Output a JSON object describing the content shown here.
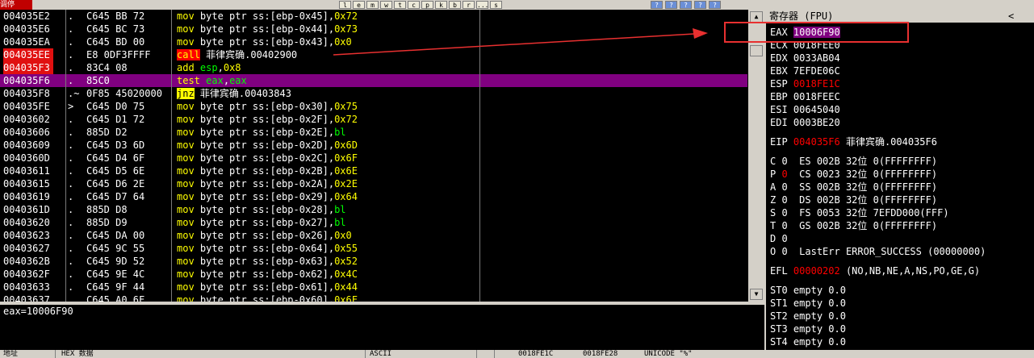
{
  "toolbar": {
    "left_tag": "调停",
    "buttons": [
      "l",
      "e",
      "m",
      "w",
      "t",
      "c",
      "p",
      "k",
      "b",
      "r",
      "...",
      "s"
    ],
    "right_icons": [
      "?",
      "?",
      "?",
      "?",
      "?"
    ]
  },
  "disasm_rows": [
    {
      "addr": "004035E2",
      "mark": ".",
      "hex": "C645 BB 72",
      "tokens": [
        {
          "t": "mov",
          "c": "mn"
        },
        {
          "t": " byte ptr ss:[ebp-0x45],",
          "c": "cn"
        },
        {
          "t": "0x72",
          "c": "num"
        }
      ]
    },
    {
      "addr": "004035E6",
      "mark": ".",
      "hex": "C645 BC 73",
      "tokens": [
        {
          "t": "mov",
          "c": "mn"
        },
        {
          "t": " byte ptr ss:[ebp-0x44],",
          "c": "cn"
        },
        {
          "t": "0x73",
          "c": "num"
        }
      ]
    },
    {
      "addr": "004035EA",
      "mark": ".",
      "hex": "C645 BD 00",
      "tokens": [
        {
          "t": "mov",
          "c": "mn"
        },
        {
          "t": " byte ptr ss:[ebp-0x43],",
          "c": "cn"
        },
        {
          "t": "0x0",
          "c": "num"
        }
      ]
    },
    {
      "addr": "004035EE",
      "addr_red": true,
      "mark": ".",
      "hex": "E8 0DF3FFFF",
      "tokens": [
        {
          "t": "call",
          "c": "mn call"
        },
        {
          "t": " 菲律宾确.00402900",
          "c": "cn"
        }
      ]
    },
    {
      "addr": "004035F3",
      "addr_red": true,
      "mark": ".",
      "hex": "83C4 08",
      "tokens": [
        {
          "t": "add",
          "c": "mn"
        },
        {
          "t": " ",
          "c": "cn"
        },
        {
          "t": "esp",
          "c": "reg"
        },
        {
          "t": ",",
          "c": "cn"
        },
        {
          "t": "0x8",
          "c": "num"
        }
      ]
    },
    {
      "addr": "004035F6",
      "current": true,
      "mark": ".",
      "hex": "85C0",
      "tokens": [
        {
          "t": "test",
          "c": "mn"
        },
        {
          "t": " ",
          "c": "cn"
        },
        {
          "t": "eax",
          "c": "reg"
        },
        {
          "t": ",",
          "c": "cn"
        },
        {
          "t": "eax",
          "c": "reg"
        }
      ]
    },
    {
      "addr": "004035F8",
      "mark": ".~",
      "hex": "0F85 45020000",
      "tokens": [
        {
          "t": "jnz",
          "c": "mn jmp"
        },
        {
          "t": " 菲律宾确.00403843",
          "c": "cn"
        }
      ]
    },
    {
      "addr": "004035FE",
      "mark": ">",
      "hex": "C645 D0 75",
      "tokens": [
        {
          "t": "mov",
          "c": "mn"
        },
        {
          "t": " byte ptr ss:[ebp-0x30],",
          "c": "cn"
        },
        {
          "t": "0x75",
          "c": "num"
        }
      ]
    },
    {
      "addr": "00403602",
      "mark": ".",
      "hex": "C645 D1 72",
      "tokens": [
        {
          "t": "mov",
          "c": "mn"
        },
        {
          "t": " byte ptr ss:[ebp-0x2F],",
          "c": "cn"
        },
        {
          "t": "0x72",
          "c": "num"
        }
      ]
    },
    {
      "addr": "00403606",
      "mark": ".",
      "hex": "885D D2",
      "tokens": [
        {
          "t": "mov",
          "c": "mn"
        },
        {
          "t": " byte ptr ss:[ebp-0x2E],",
          "c": "cn"
        },
        {
          "t": "bl",
          "c": "reg"
        }
      ]
    },
    {
      "addr": "00403609",
      "mark": ".",
      "hex": "C645 D3 6D",
      "tokens": [
        {
          "t": "mov",
          "c": "mn"
        },
        {
          "t": " byte ptr ss:[ebp-0x2D],",
          "c": "cn"
        },
        {
          "t": "0x6D",
          "c": "num"
        }
      ]
    },
    {
      "addr": "0040360D",
      "mark": ".",
      "hex": "C645 D4 6F",
      "tokens": [
        {
          "t": "mov",
          "c": "mn"
        },
        {
          "t": " byte ptr ss:[ebp-0x2C],",
          "c": "cn"
        },
        {
          "t": "0x6F",
          "c": "num"
        }
      ]
    },
    {
      "addr": "00403611",
      "mark": ".",
      "hex": "C645 D5 6E",
      "tokens": [
        {
          "t": "mov",
          "c": "mn"
        },
        {
          "t": " byte ptr ss:[ebp-0x2B],",
          "c": "cn"
        },
        {
          "t": "0x6E",
          "c": "num"
        }
      ]
    },
    {
      "addr": "00403615",
      "mark": ".",
      "hex": "C645 D6 2E",
      "tokens": [
        {
          "t": "mov",
          "c": "mn"
        },
        {
          "t": " byte ptr ss:[ebp-0x2A],",
          "c": "cn"
        },
        {
          "t": "0x2E",
          "c": "num"
        }
      ]
    },
    {
      "addr": "00403619",
      "mark": ".",
      "hex": "C645 D7 64",
      "tokens": [
        {
          "t": "mov",
          "c": "mn"
        },
        {
          "t": " byte ptr ss:[ebp-0x29],",
          "c": "cn"
        },
        {
          "t": "0x64",
          "c": "num"
        }
      ]
    },
    {
      "addr": "0040361D",
      "mark": ".",
      "hex": "885D D8",
      "tokens": [
        {
          "t": "mov",
          "c": "mn"
        },
        {
          "t": " byte ptr ss:[ebp-0x28],",
          "c": "cn"
        },
        {
          "t": "bl",
          "c": "reg"
        }
      ]
    },
    {
      "addr": "00403620",
      "mark": ".",
      "hex": "885D D9",
      "tokens": [
        {
          "t": "mov",
          "c": "mn"
        },
        {
          "t": " byte ptr ss:[ebp-0x27],",
          "c": "cn"
        },
        {
          "t": "bl",
          "c": "reg"
        }
      ]
    },
    {
      "addr": "00403623",
      "mark": ".",
      "hex": "C645 DA 00",
      "tokens": [
        {
          "t": "mov",
          "c": "mn"
        },
        {
          "t": " byte ptr ss:[ebp-0x26],",
          "c": "cn"
        },
        {
          "t": "0x0",
          "c": "num"
        }
      ]
    },
    {
      "addr": "00403627",
      "mark": ".",
      "hex": "C645 9C 55",
      "tokens": [
        {
          "t": "mov",
          "c": "mn"
        },
        {
          "t": " byte ptr ss:[ebp-0x64],",
          "c": "cn"
        },
        {
          "t": "0x55",
          "c": "num"
        }
      ]
    },
    {
      "addr": "0040362B",
      "mark": ".",
      "hex": "C645 9D 52",
      "tokens": [
        {
          "t": "mov",
          "c": "mn"
        },
        {
          "t": " byte ptr ss:[ebp-0x63],",
          "c": "cn"
        },
        {
          "t": "0x52",
          "c": "num"
        }
      ]
    },
    {
      "addr": "0040362F",
      "mark": ".",
      "hex": "C645 9E 4C",
      "tokens": [
        {
          "t": "mov",
          "c": "mn"
        },
        {
          "t": " byte ptr ss:[ebp-0x62],",
          "c": "cn"
        },
        {
          "t": "0x4C",
          "c": "num"
        }
      ]
    },
    {
      "addr": "00403633",
      "mark": ".",
      "hex": "C645 9F 44",
      "tokens": [
        {
          "t": "mov",
          "c": "mn"
        },
        {
          "t": " byte ptr ss:[ebp-0x61],",
          "c": "cn"
        },
        {
          "t": "0x44",
          "c": "num"
        }
      ]
    },
    {
      "addr": "00403637",
      "mark": ".",
      "hex": "C645 A0 6F",
      "tokens": [
        {
          "t": "mov",
          "c": "mn"
        },
        {
          "t": " byte ptr ss:[ebp-0x60],",
          "c": "cn"
        },
        {
          "t": "0x6F",
          "c": "num"
        }
      ]
    }
  ],
  "info_line": "eax=10006F90",
  "registers": {
    "header": "寄存器 (FPU)",
    "chevron": "<",
    "gp": [
      {
        "name": "EAX",
        "value": "10006F90",
        "style": "hi"
      },
      {
        "name": "ECX",
        "value": "0018FEE0",
        "style": ""
      },
      {
        "name": "EDX",
        "value": "0033AB04",
        "style": ""
      },
      {
        "name": "EBX",
        "value": "7EFDE06C",
        "style": ""
      },
      {
        "name": "ESP",
        "value": "0018FE1C",
        "style": "red"
      },
      {
        "name": "EBP",
        "value": "0018FEEC",
        "style": ""
      },
      {
        "name": "ESI",
        "value": "00645040",
        "style": ""
      },
      {
        "name": "EDI",
        "value": "0003BE20",
        "style": ""
      }
    ],
    "eip": {
      "name": "EIP",
      "value": "004035F6",
      "comment": "菲律宾确.004035F6"
    },
    "flags": [
      {
        "f": "C",
        "v": "0",
        "red": false,
        "rest": "ES 002B 32位 0(FFFFFFFF)"
      },
      {
        "f": "P",
        "v": "0",
        "red": true,
        "rest": "CS 0023 32位 0(FFFFFFFF)"
      },
      {
        "f": "A",
        "v": "0",
        "red": false,
        "rest": "SS 002B 32位 0(FFFFFFFF)"
      },
      {
        "f": "Z",
        "v": "0",
        "red": false,
        "rest": "DS 002B 32位 0(FFFFFFFF)"
      },
      {
        "f": "S",
        "v": "0",
        "red": false,
        "rest": "FS 0053 32位 7EFDD000(FFF)"
      },
      {
        "f": "T",
        "v": "0",
        "red": false,
        "rest": "GS 002B 32位 0(FFFFFFFF)"
      },
      {
        "f": "D",
        "v": "0",
        "red": false,
        "rest": ""
      },
      {
        "f": "O",
        "v": "0",
        "red": false,
        "rest": "LastErr ERROR_SUCCESS (00000000)"
      }
    ],
    "efl": {
      "name": "EFL",
      "value": "00000202",
      "comment": "(NO,NB,NE,A,NS,PO,GE,G)"
    },
    "fpu": [
      {
        "name": "ST0",
        "value": "empty 0.0"
      },
      {
        "name": "ST1",
        "value": "empty 0.0"
      },
      {
        "name": "ST2",
        "value": "empty 0.0"
      },
      {
        "name": "ST3",
        "value": "empty 0.0"
      },
      {
        "name": "ST4",
        "value": "empty 0.0"
      }
    ]
  },
  "bottom_bar": {
    "address_label": "地址",
    "hex_label": "HEX 数据",
    "ascii_label": "ASCII",
    "stack_addr": "0018FE1C",
    "stack_val": "0018FE28",
    "stack_comment": "UNICODE \"%\""
  },
  "colors": {
    "annotation_red": "#e83030",
    "current_line": "#800080",
    "mnemonic": "#ffff00",
    "register": "#00ff00"
  }
}
